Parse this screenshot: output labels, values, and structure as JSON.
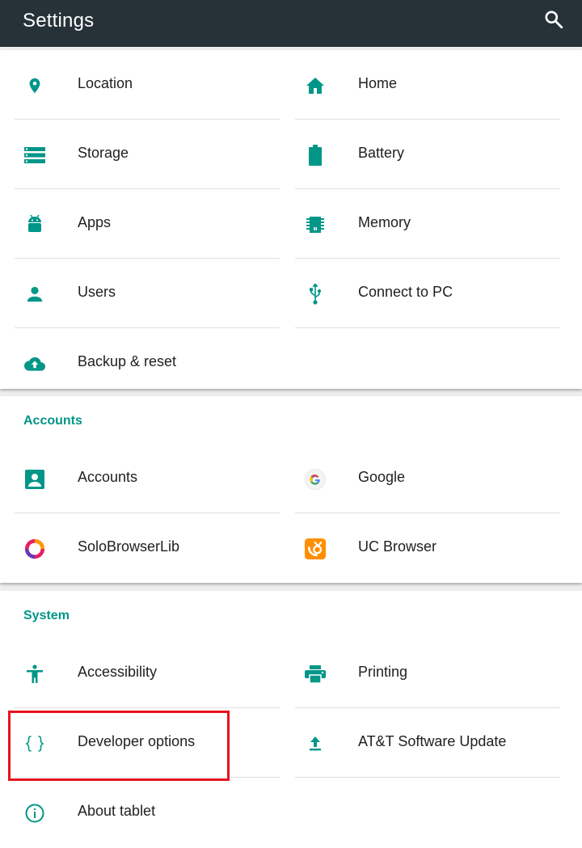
{
  "appbar": {
    "title": "Settings",
    "search_icon": "search-icon"
  },
  "colors": {
    "appbar_bg": "#263238",
    "accent": "#009688",
    "highlight": "#e8131f"
  },
  "device": {
    "left": [
      {
        "label": "Location",
        "icon": "location-icon"
      },
      {
        "label": "Storage",
        "icon": "storage-icon"
      },
      {
        "label": "Apps",
        "icon": "android-icon"
      },
      {
        "label": "Users",
        "icon": "person-icon"
      },
      {
        "label": "Backup & reset",
        "icon": "cloud-upload-icon"
      }
    ],
    "right": [
      {
        "label": "Home",
        "icon": "home-icon"
      },
      {
        "label": "Battery",
        "icon": "battery-icon"
      },
      {
        "label": "Memory",
        "icon": "memory-icon"
      },
      {
        "label": "Connect to PC",
        "icon": "usb-icon"
      }
    ]
  },
  "accounts": {
    "title": "Accounts",
    "left": [
      {
        "label": "Accounts",
        "icon": "account-box-icon"
      },
      {
        "label": "SoloBrowserLib",
        "icon": "solo-browser-icon"
      }
    ],
    "right": [
      {
        "label": "Google",
        "icon": "google-icon"
      },
      {
        "label": "UC Browser",
        "icon": "uc-browser-icon"
      }
    ]
  },
  "system": {
    "title": "System",
    "left": [
      {
        "label": "Accessibility",
        "icon": "accessibility-icon"
      },
      {
        "label": "Developer options",
        "icon": "code-braces-icon"
      },
      {
        "label": "About tablet",
        "icon": "info-icon"
      }
    ],
    "right": [
      {
        "label": "Printing",
        "icon": "print-icon"
      },
      {
        "label": "AT&T Software Update",
        "icon": "system-update-icon"
      }
    ]
  }
}
